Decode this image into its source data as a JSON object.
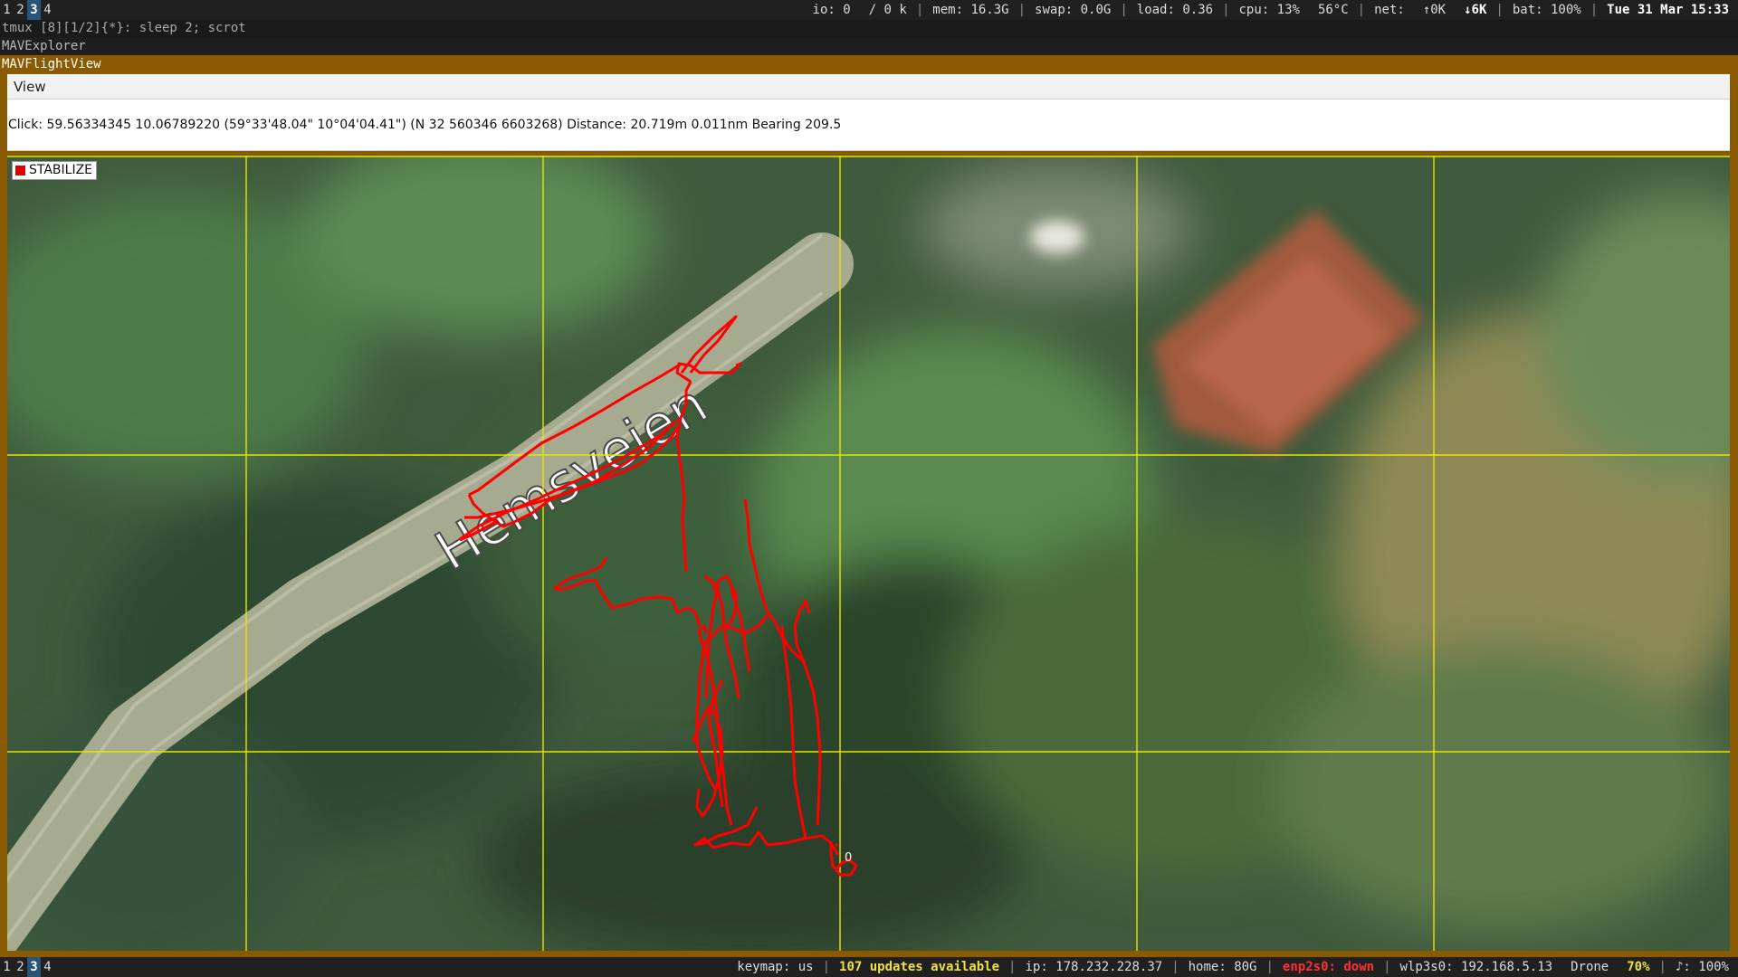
{
  "topbar": {
    "workspaces": [
      "1",
      "2",
      "3",
      "4"
    ],
    "active_workspace": "3",
    "io": "io: 0",
    "disk": "/    0 k",
    "mem": "mem: 16.3G",
    "swap": "swap: 0.0G",
    "load": "load: 0.36",
    "cpu": "cpu:  13%",
    "temp": "56°C",
    "net_label": "net:",
    "net_up": "↑0K",
    "net_down": "↓6K",
    "bat": "bat: 100%",
    "datetime": "Tue 31 Mar 15:33"
  },
  "tmux": {
    "text": "tmux [8][1/2]{*}:  sleep 2; scrot"
  },
  "windows": {
    "title1": "MAVExplorer",
    "title2": "MAVFlightView"
  },
  "menu": {
    "view_label": "View"
  },
  "info": {
    "text": "Click: 59.56334345 10.06789220 (59°33'48.04\" 10°04'04.41\") (N 32 560346 6603268)  Distance: 20.719m 0.011nm Bearing 209.5"
  },
  "map": {
    "mode_label": "STABILIZE",
    "road_label": "Hemsveien",
    "waypoint_label": "0",
    "colors": {
      "track": "#ff0000",
      "grid": "#e6e600",
      "mode_marker": "#e00000"
    }
  },
  "bottombar": {
    "workspaces": [
      "1",
      "2",
      "3",
      "4"
    ],
    "active_workspace": "3",
    "keymap": "keymap: us",
    "updates": "107 updates available",
    "ip": "ip: 178.232.228.37",
    "home": "home: 80G",
    "eth": "enp2s0: down",
    "wlan": "wlp3s0: 192.168.5.13",
    "ssid": "Drone",
    "signal": "70%",
    "volume": "♪: 100%"
  }
}
